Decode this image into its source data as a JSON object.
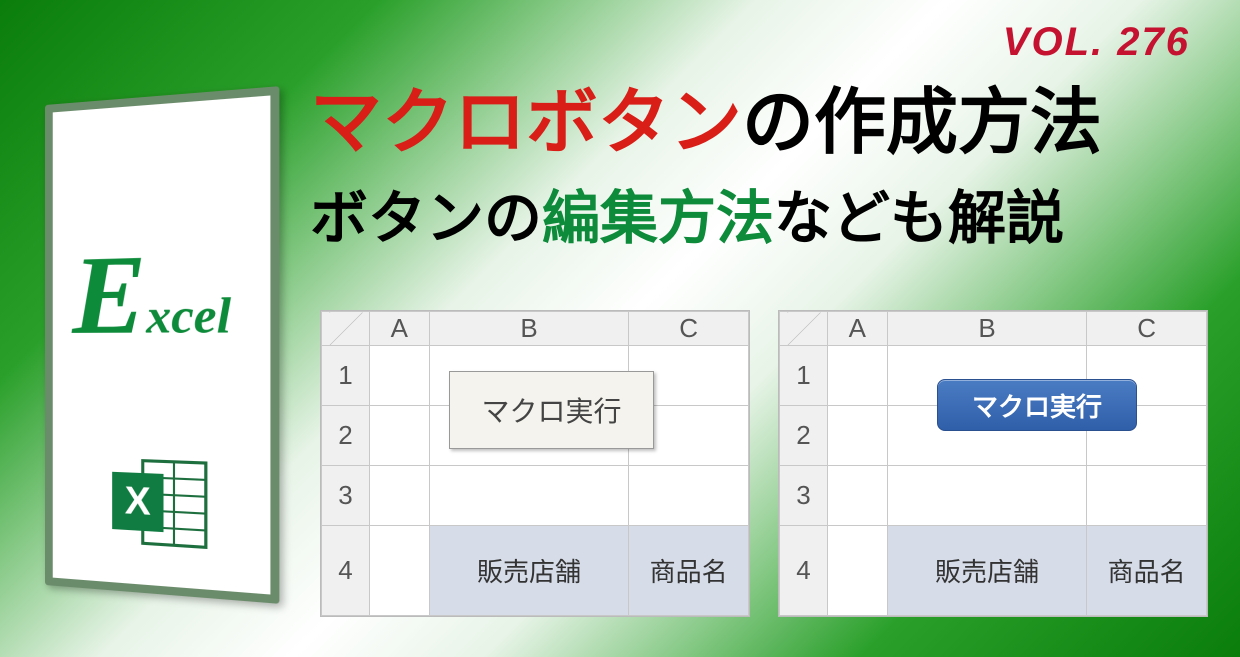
{
  "volume": "VOL. 276",
  "title1": {
    "red": "マクロボタン",
    "black": "の作成方法"
  },
  "title2": {
    "prefix": "ボタンの",
    "green": "編集方法",
    "suffix": "なども解説"
  },
  "logo": {
    "e": "E",
    "rest": "xcel"
  },
  "sheet": {
    "cols": [
      "A",
      "B",
      "C"
    ],
    "rows": [
      "1",
      "2",
      "3",
      "4"
    ],
    "header_b": "販売店舗",
    "header_c": "商品名"
  },
  "buttons": {
    "plain": "マクロ実行",
    "styled": "マクロ実行"
  }
}
